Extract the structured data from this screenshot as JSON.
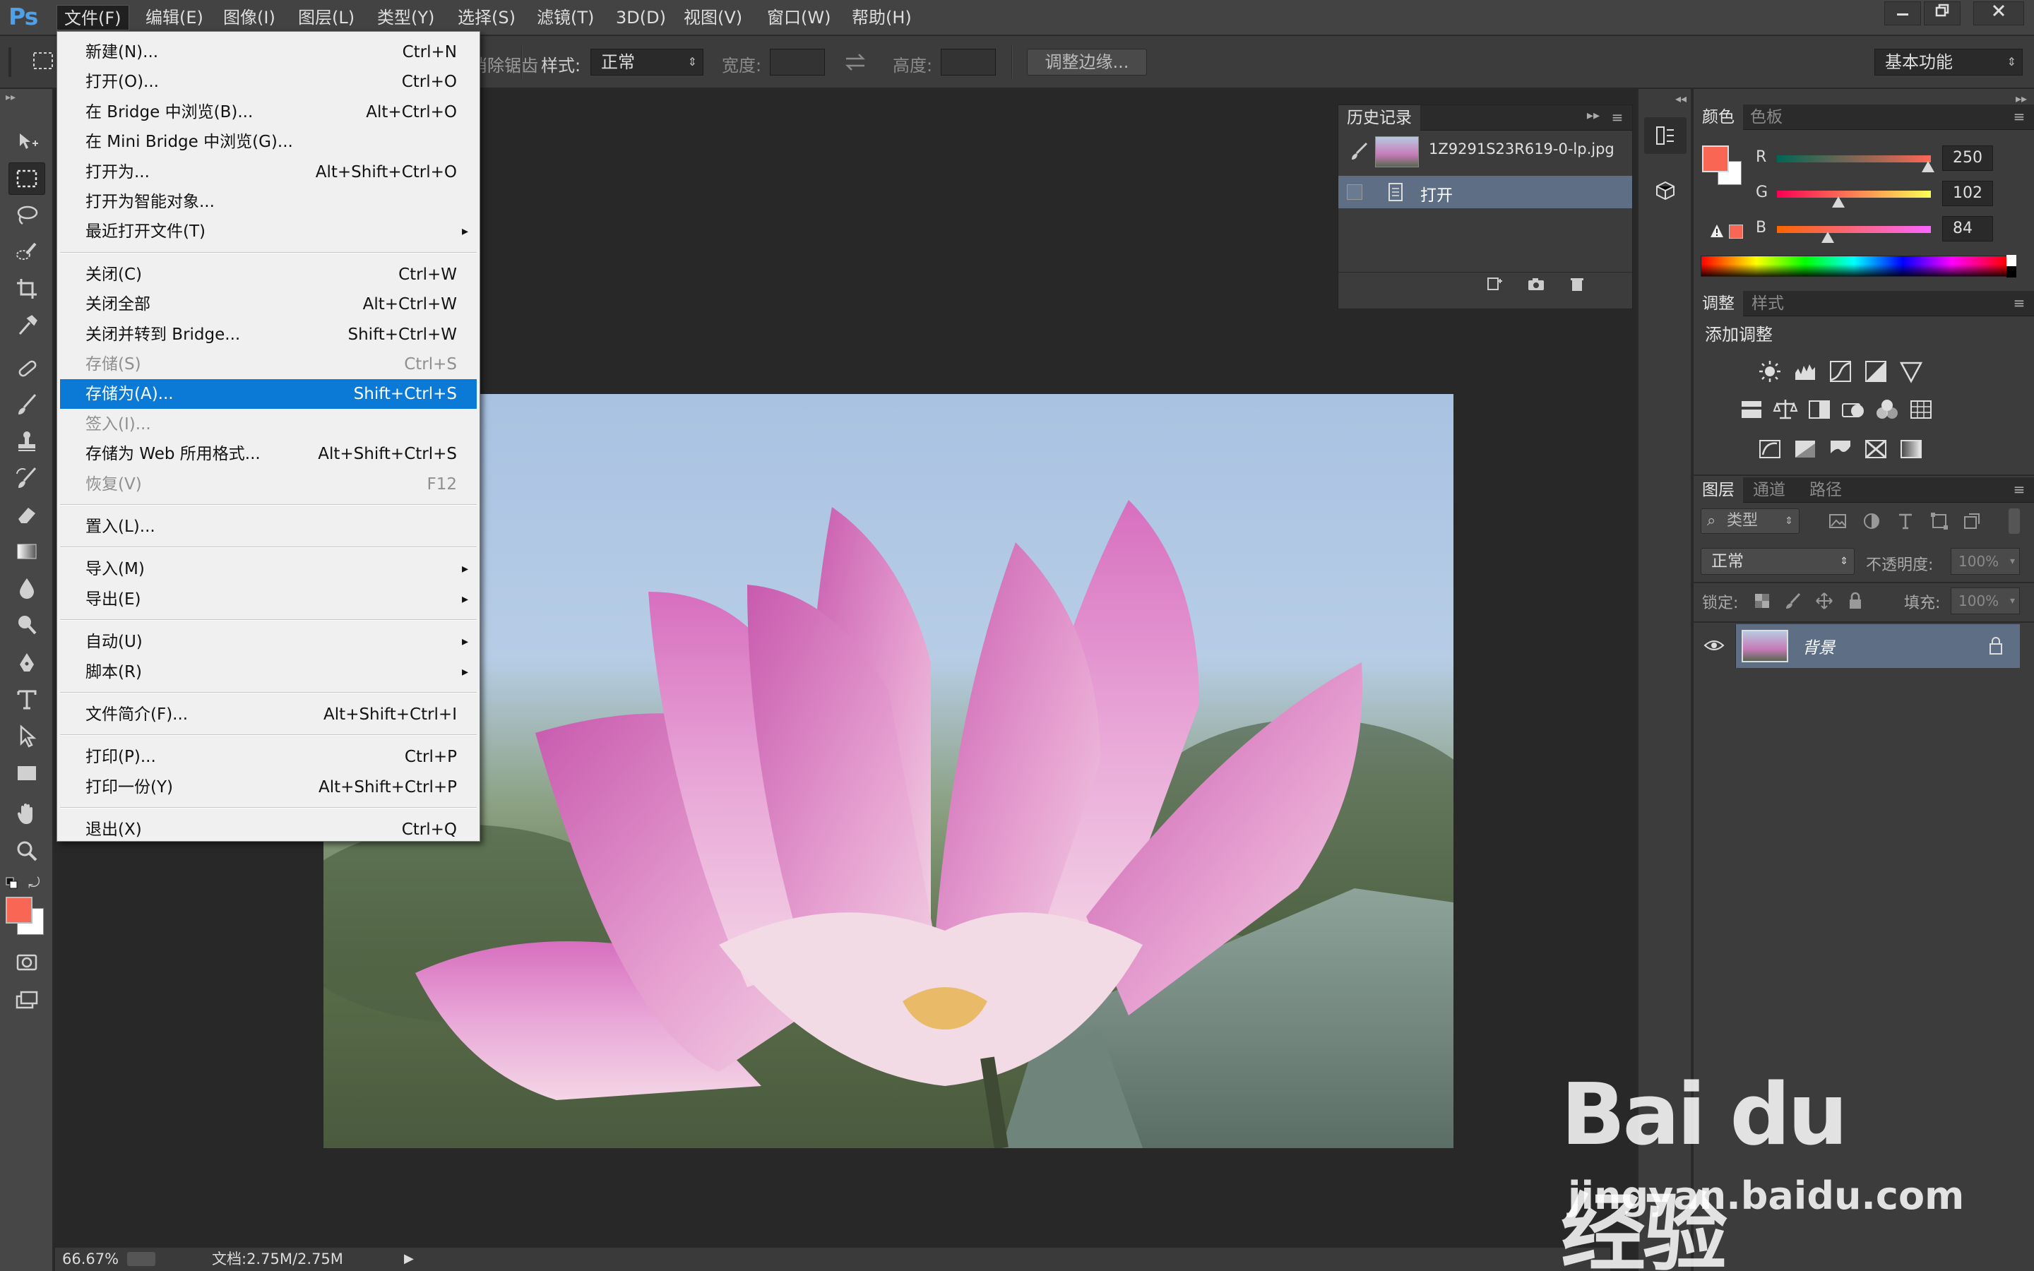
{
  "menubar": {
    "logo": "Ps",
    "items": [
      "文件(F)",
      "编辑(E)",
      "图像(I)",
      "图层(L)",
      "类型(Y)",
      "选择(S)",
      "滤镜(T)",
      "3D(D)",
      "视图(V)",
      "窗口(W)",
      "帮助(H)"
    ],
    "window_buttons": [
      "minimize",
      "restore",
      "close"
    ]
  },
  "options": {
    "partial_label": "消除锯齿",
    "style_label": "样式:",
    "style_value": "正常",
    "width_label": "宽度:",
    "height_label": "高度:",
    "refine_edge_button": "调整边缘...",
    "workspace": "基本功能"
  },
  "file_menu": {
    "groups": [
      [
        {
          "label": "新建(N)...",
          "shortcut": "Ctrl+N"
        },
        {
          "label": "打开(O)...",
          "shortcut": "Ctrl+O"
        },
        {
          "label": "在 Bridge 中浏览(B)...",
          "shortcut": "Alt+Ctrl+O"
        },
        {
          "label": "在 Mini Bridge 中浏览(G)...",
          "shortcut": ""
        },
        {
          "label": "打开为...",
          "shortcut": "Alt+Shift+Ctrl+O"
        },
        {
          "label": "打开为智能对象...",
          "shortcut": ""
        },
        {
          "label": "最近打开文件(T)",
          "shortcut": "",
          "submenu": true
        }
      ],
      [
        {
          "label": "关闭(C)",
          "shortcut": "Ctrl+W"
        },
        {
          "label": "关闭全部",
          "shortcut": "Alt+Ctrl+W"
        },
        {
          "label": "关闭并转到 Bridge...",
          "shortcut": "Shift+Ctrl+W"
        },
        {
          "label": "存储(S)",
          "shortcut": "Ctrl+S",
          "disabled": true
        },
        {
          "label": "存储为(A)...",
          "shortcut": "Shift+Ctrl+S",
          "highlight": true
        },
        {
          "label": "签入(I)...",
          "shortcut": "",
          "disabled": true
        },
        {
          "label": "存储为 Web 所用格式...",
          "shortcut": "Alt+Shift+Ctrl+S"
        },
        {
          "label": "恢复(V)",
          "shortcut": "F12",
          "disabled": true
        }
      ],
      [
        {
          "label": "置入(L)...",
          "shortcut": ""
        }
      ],
      [
        {
          "label": "导入(M)",
          "shortcut": "",
          "submenu": true
        },
        {
          "label": "导出(E)",
          "shortcut": "",
          "submenu": true
        }
      ],
      [
        {
          "label": "自动(U)",
          "shortcut": "",
          "submenu": true
        },
        {
          "label": "脚本(R)",
          "shortcut": "",
          "submenu": true
        }
      ],
      [
        {
          "label": "文件简介(F)...",
          "shortcut": "Alt+Shift+Ctrl+I"
        }
      ],
      [
        {
          "label": "打印(P)...",
          "shortcut": "Ctrl+P"
        },
        {
          "label": "打印一份(Y)",
          "shortcut": "Alt+Shift+Ctrl+P"
        }
      ],
      [
        {
          "label": "退出(X)",
          "shortcut": "Ctrl+Q"
        }
      ]
    ]
  },
  "history": {
    "tab": "历史记录",
    "snapshot_name": "1Z9291S23R619-0-lp.jpg",
    "items": [
      "打开"
    ]
  },
  "color_panel": {
    "tabs": [
      "颜色",
      "色板"
    ],
    "r_label": "R",
    "g_label": "G",
    "b_label": "B",
    "r": 250,
    "g": 102,
    "b": 84,
    "foreground": "#fa6654",
    "background": "#ffffff"
  },
  "adjustments_panel": {
    "tabs": [
      "调整",
      "样式"
    ],
    "heading": "添加调整"
  },
  "layers_panel": {
    "tabs": [
      "图层",
      "通道",
      "路径"
    ],
    "filter_kind": "类型",
    "blend_mode": "正常",
    "opacity_label": "不透明度:",
    "opacity_value": "100%",
    "lock_label": "锁定:",
    "fill_label": "填充:",
    "fill_value": "100%",
    "layer_name": "背景"
  },
  "status": {
    "zoom": "66.67%",
    "doc_info": "文档:2.75M/2.75M"
  },
  "watermark": {
    "brand": "Bai du 经验",
    "url": "jingyan.baidu.com"
  },
  "colors": {
    "accent": "#0a7ad6",
    "foreground_swatch": "#fa6654"
  }
}
